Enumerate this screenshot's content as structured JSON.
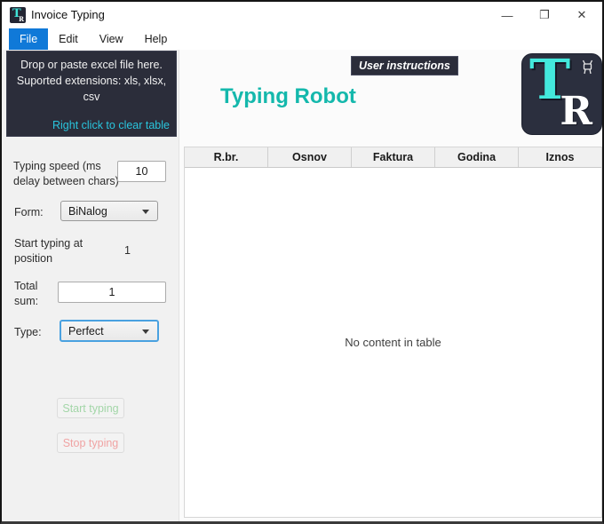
{
  "window": {
    "title": "Invoice Typing",
    "controls": {
      "minimize": "—",
      "maximize": "❐",
      "close": "✕"
    }
  },
  "menu": {
    "items": [
      {
        "label": "File"
      },
      {
        "label": "Edit"
      },
      {
        "label": "View"
      },
      {
        "label": "Help"
      }
    ]
  },
  "drop_panel": {
    "lines": [
      "Drop or paste excel file here.",
      "Suported extensions: xls, xlsx,",
      "csv"
    ],
    "hint": "Right click to clear table"
  },
  "header": {
    "user_instructions_label": "User instructions",
    "app_title": "Typing Robot",
    "logo": {
      "t": "T",
      "r": "R"
    }
  },
  "sidebar": {
    "typing_speed": {
      "label": "Typing speed (ms delay between chars)",
      "value": "10"
    },
    "form": {
      "label": "Form:",
      "value": "BiNalog"
    },
    "start_position": {
      "label": "Start typing at position",
      "value": "1"
    },
    "total_sum": {
      "label": "Total sum:",
      "value": "1"
    },
    "type": {
      "label": "Type:",
      "value": "Perfect"
    },
    "start_button_label": "Start typing",
    "stop_button_label": "Stop typing"
  },
  "table": {
    "columns": [
      "R.br.",
      "Osnov",
      "Faktura",
      "Godina",
      "Iznos"
    ],
    "rows": [],
    "empty_text": "No content in table"
  },
  "colors": {
    "accent_teal": "#14b8ac",
    "logo_cyan": "#43e8dc",
    "hint_cyan": "#29c5dd",
    "menu_active_blue": "#1079d8",
    "panel_dark": "#2b2d3a",
    "focus_blue": "#49a1e0",
    "start_green": "#a3d6a8",
    "stop_red": "#f0a3a3"
  }
}
